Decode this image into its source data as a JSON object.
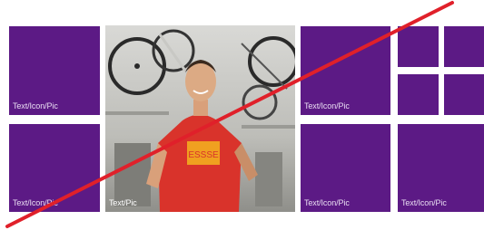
{
  "tiles": [
    {
      "label": "Text/Icon/Pic"
    },
    {
      "label": "Text/Icon/Pic"
    },
    {
      "label": "Text/Pic"
    },
    {
      "label": "Text/Icon/Pic"
    },
    {
      "label": "Text/Icon/Pic"
    },
    {
      "label": "Text/Icon/Pic"
    }
  ],
  "colors": {
    "tile": "#5c1a85",
    "strike_line": "#e0202a"
  },
  "photo": {
    "shirt_print": "ESSSE"
  }
}
